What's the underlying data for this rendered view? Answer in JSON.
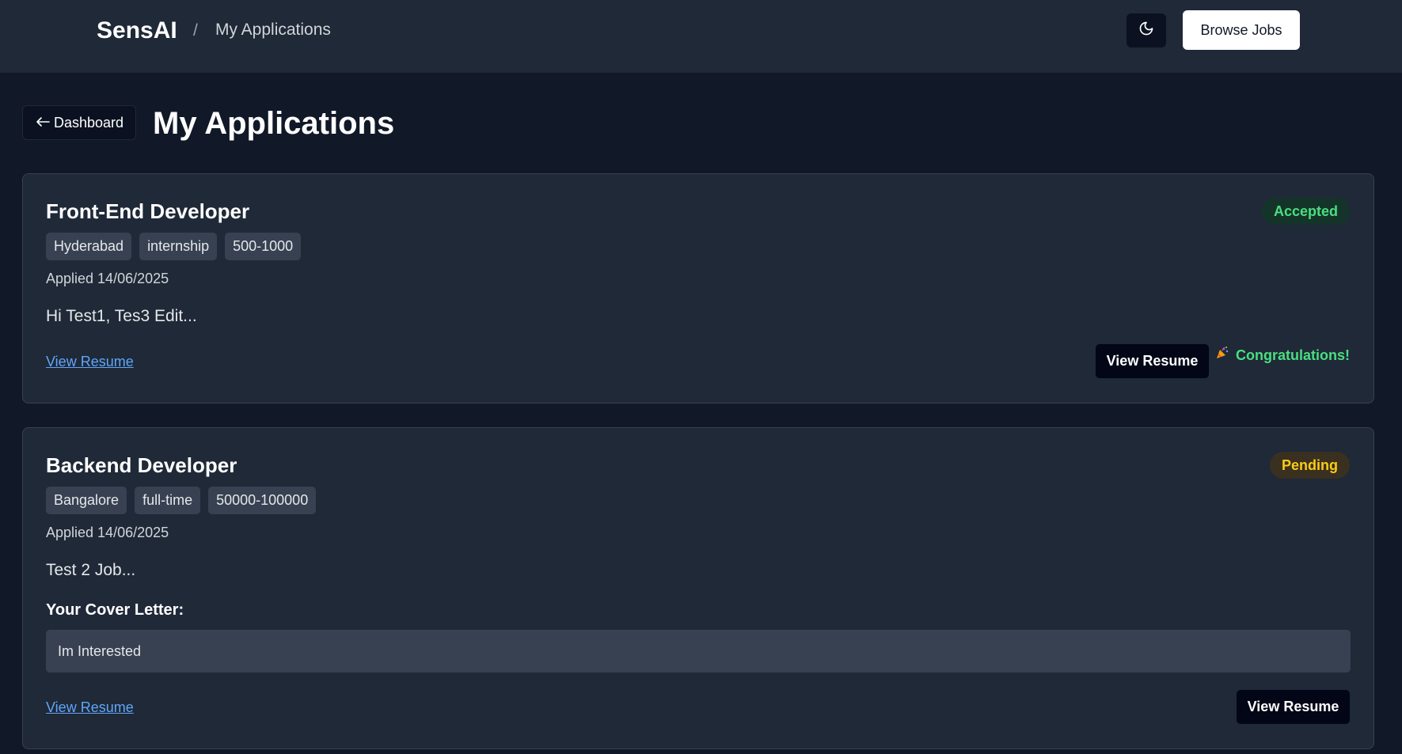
{
  "header": {
    "brand": "SensAI",
    "breadcrumb_separator": "/",
    "breadcrumb_current": "My Applications",
    "theme_toggle_icon": "moon-icon",
    "browse_jobs_label": "Browse Jobs"
  },
  "page": {
    "back_label": "Dashboard",
    "back_icon": "arrow-left-icon",
    "title": "My Applications"
  },
  "applications": [
    {
      "title": "Front-End Developer",
      "status": "Accepted",
      "status_color": "#4ade80",
      "tags": [
        "Hyderabad",
        "internship",
        "500-1000"
      ],
      "applied": "Applied 14/06/2025",
      "description": "Hi Test1, Tes3 Edit...",
      "resume_link": "View Resume",
      "resume_button": "View Resume",
      "message": "Congratulations!",
      "message_icon": "party-popper-icon"
    },
    {
      "title": "Backend Developer",
      "status": "Pending",
      "status_color": "#facc15",
      "tags": [
        "Bangalore",
        "full-time",
        "50000-100000"
      ],
      "applied": "Applied 14/06/2025",
      "description": "Test 2 Job...",
      "cover_letter_label": "Your Cover Letter:",
      "cover_letter": "Im Interested",
      "resume_link": "View Resume",
      "resume_button": "View Resume"
    }
  ]
}
